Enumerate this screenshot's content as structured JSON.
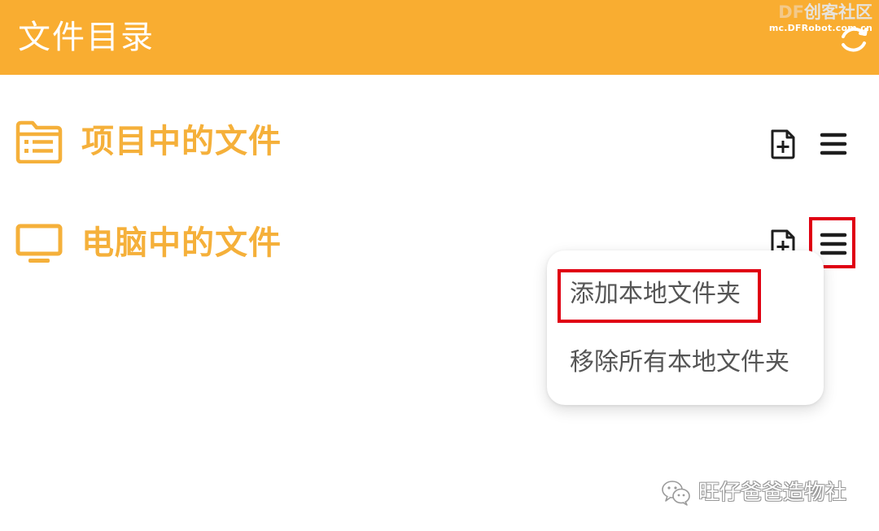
{
  "header": {
    "title": "文件目录",
    "refresh_icon": "refresh-icon",
    "background_color": "#f9ad31"
  },
  "watermark_top": {
    "logo_prefix": "DF",
    "logo_text": "创客社区",
    "url": "mc.DFRobot.com.cn"
  },
  "sections": [
    {
      "label": "项目中的文件",
      "icon": "folder-list-icon",
      "actions": [
        "add-file-icon",
        "menu-icon"
      ]
    },
    {
      "label": "电脑中的文件",
      "icon": "monitor-icon",
      "actions": [
        "add-file-icon",
        "menu-icon"
      ]
    }
  ],
  "dropdown": {
    "items": [
      {
        "label": "添加本地文件夹"
      },
      {
        "label": "移除所有本地文件夹"
      }
    ]
  },
  "watermark_bottom": {
    "text": "旺仔爸爸造物社",
    "icon": "wechat-icon"
  },
  "colors": {
    "accent": "#f5b03a",
    "highlight": "#e00012",
    "icon_dark": "#1e1e1e"
  }
}
